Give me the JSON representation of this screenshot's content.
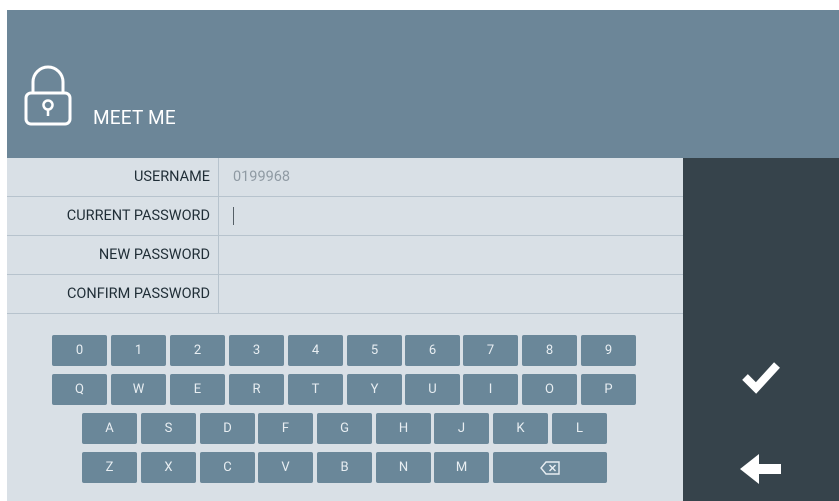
{
  "header": {
    "title": "MEET ME",
    "icon": "lock-icon"
  },
  "form": {
    "username_label": "USERNAME",
    "username_value": "0199968",
    "current_password_label": "CURRENT PASSWORD",
    "current_password_value": "",
    "new_password_label": "NEW PASSWORD",
    "new_password_value": "",
    "confirm_password_label": "CONFIRM PASSWORD",
    "confirm_password_value": ""
  },
  "keyboard": {
    "row1": [
      "0",
      "1",
      "2",
      "3",
      "4",
      "5",
      "6",
      "7",
      "8",
      "9"
    ],
    "row2": [
      "Q",
      "W",
      "E",
      "R",
      "T",
      "Y",
      "U",
      "I",
      "O",
      "P"
    ],
    "row3": [
      "A",
      "S",
      "D",
      "F",
      "G",
      "H",
      "J",
      "K",
      "L"
    ],
    "row4": [
      "Z",
      "X",
      "C",
      "V",
      "B",
      "N",
      "M"
    ],
    "backspace_icon": "backspace-icon"
  },
  "side": {
    "confirm_icon": "checkmark-icon",
    "back_icon": "arrow-left-icon"
  },
  "colors": {
    "header_bg": "#6c8698",
    "form_bg": "#d9e0e6",
    "key_bg": "#6a8799",
    "side_bg": "#36434b"
  }
}
